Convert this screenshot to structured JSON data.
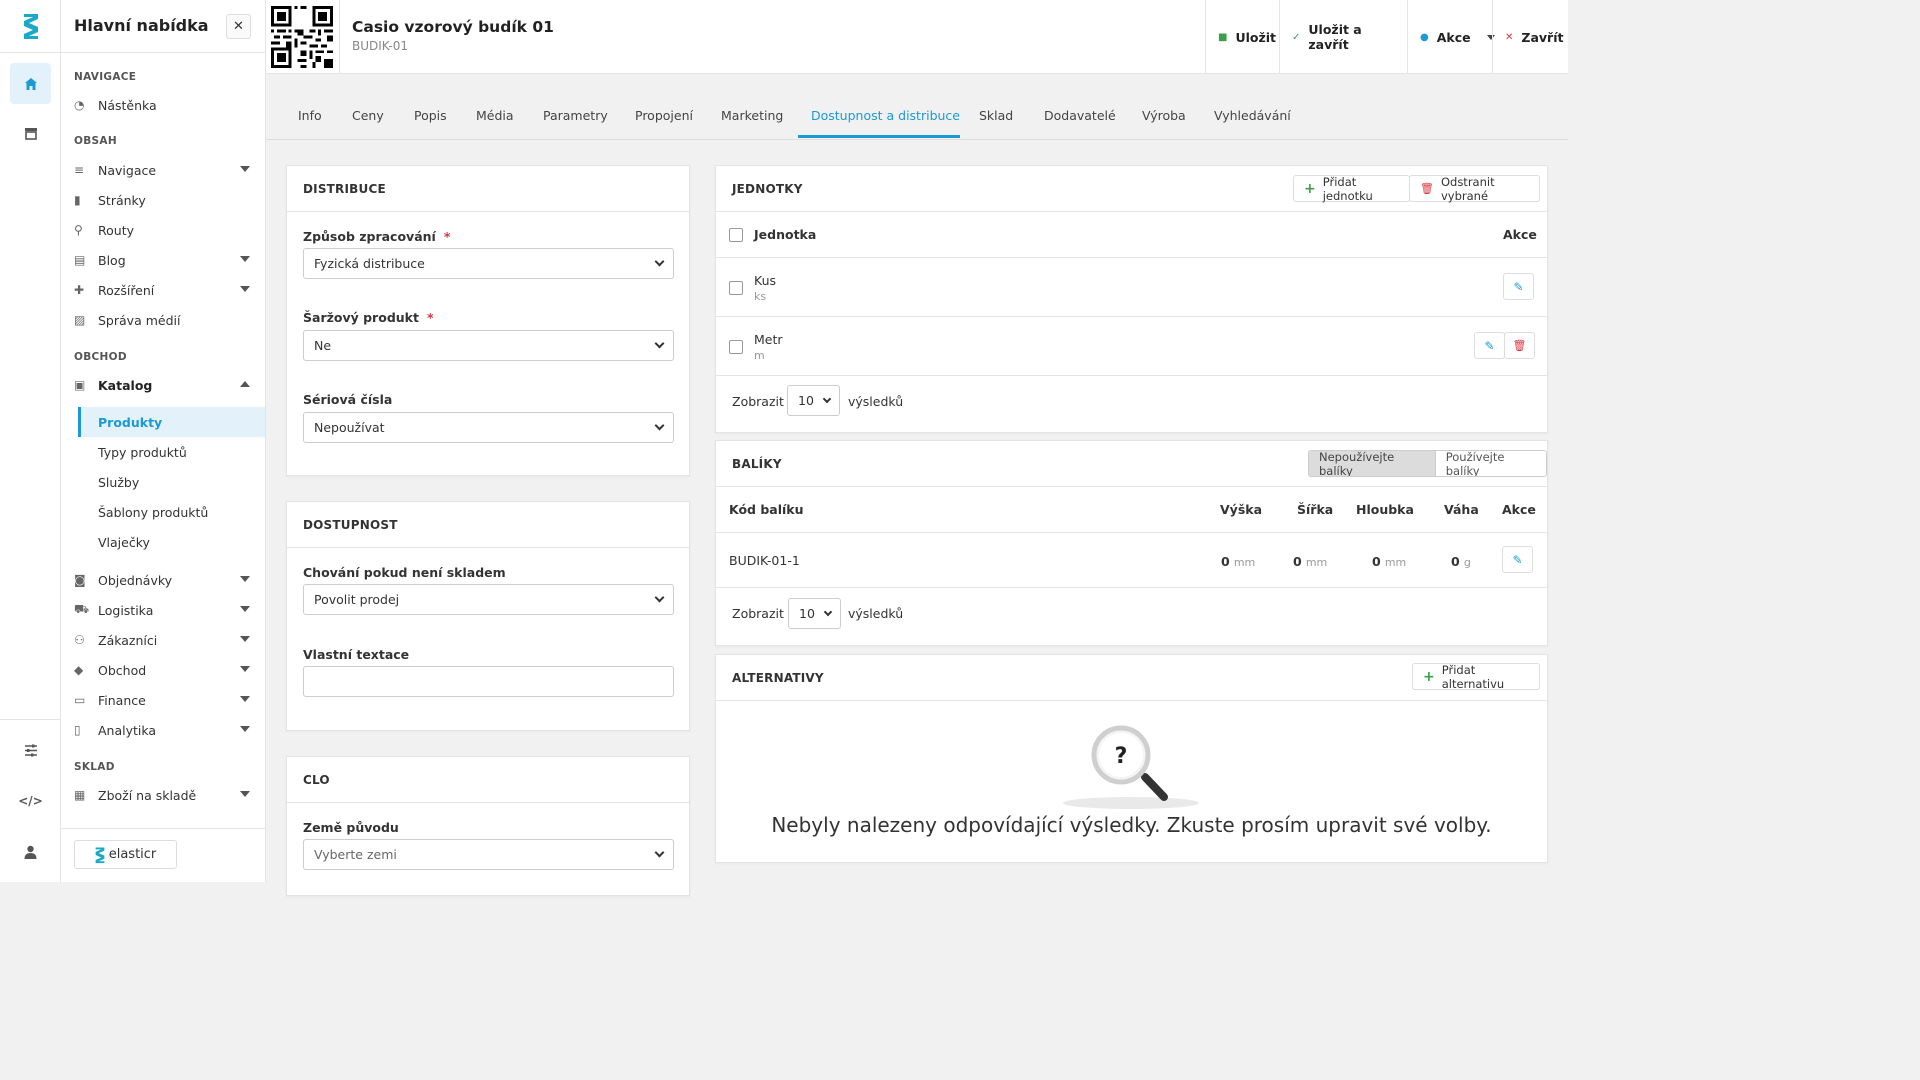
{
  "menu": {
    "title": "Hlavní nabídka",
    "sections": {
      "navigace": "NAVIGACE",
      "obsah": "OBSAH",
      "obchod": "OBCHOD",
      "sklad": "SKLAD"
    },
    "items": {
      "nastenka": "Nástěnka",
      "navigace": "Navigace",
      "stranky": "Stránky",
      "routy": "Routy",
      "blog": "Blog",
      "rozsireni": "Rozšíření",
      "sprava_medii": "Správa médií",
      "katalog": "Katalog",
      "produkty": "Produkty",
      "typy_produktu": "Typy produktů",
      "sluzby": "Služby",
      "sablony_produktu": "Šablony produktů",
      "vlajecky": "Vlaječky",
      "objednavky": "Objednávky",
      "logistika": "Logistika",
      "zakaznici": "Zákazníci",
      "obchod": "Obchod",
      "finance": "Finance",
      "analytika": "Analytika",
      "zbozi_na_sklade": "Zboží na skladě"
    },
    "brand": "elasticr"
  },
  "header": {
    "title": "Casio vzorový budík 01",
    "code": "BUDIK-01",
    "save": "Uložit",
    "save_close": "Uložit a zavřít",
    "actions": "Akce",
    "close": "Zavřít"
  },
  "tabs": [
    "Info",
    "Ceny",
    "Popis",
    "Média",
    "Parametry",
    "Propojení",
    "Marketing",
    "Dostupnost a distribuce",
    "Sklad",
    "Dodavatelé",
    "Výroba",
    "Vyhledávání"
  ],
  "distribuce": {
    "title": "DISTRIBUCE",
    "zpusob_label": "Způsob zpracování",
    "zpusob_value": "Fyzická distribuce",
    "sarzovy_label": "Šaržový produkt",
    "sarzovy_value": "Ne",
    "seriova_label": "Sériová čísla",
    "seriova_value": "Nepoužívat",
    "required_mark": "*"
  },
  "dostupnost": {
    "title": "DOSTUPNOST",
    "chovani_label": "Chování pokud není skladem",
    "chovani_value": "Povolit prodej",
    "textace_label": "Vlastní textace",
    "textace_value": ""
  },
  "clo": {
    "title": "CLO",
    "zeme_label": "Země původu",
    "zeme_placeholder": "Vyberte zemi"
  },
  "jednotky": {
    "title": "JEDNOTKY",
    "add": "Přidat jednotku",
    "remove": "Odstranit vybrané",
    "col_unit": "Jednotka",
    "col_actions": "Akce",
    "rows": [
      {
        "name": "Kus",
        "abbr": "ks"
      },
      {
        "name": "Metr",
        "abbr": "m"
      }
    ],
    "show": "Zobrazit",
    "per_page": "10",
    "results": "výsledků"
  },
  "baliky": {
    "title": "BALÍKY",
    "toggle_off": "Nepoužívejte balíky",
    "toggle_on": "Používejte balíky",
    "cols": {
      "code": "Kód balíku",
      "height": "Výška",
      "width": "Šířka",
      "depth": "Hloubka",
      "weight": "Váha",
      "actions": "Akce"
    },
    "rows": [
      {
        "code": "BUDIK-01-1",
        "height": "0",
        "height_unit": "mm",
        "width": "0",
        "width_unit": "mm",
        "depth": "0",
        "depth_unit": "mm",
        "weight": "0",
        "weight_unit": "g"
      }
    ],
    "show": "Zobrazit",
    "per_page": "10",
    "results": "výsledků"
  },
  "alternativy": {
    "title": "ALTERNATIVY",
    "add": "Přidat alternativu",
    "empty_icon_char": "?",
    "empty": "Nebyly nalezeny odpovídající výsledky. Zkuste prosím upravit své volby."
  },
  "colors": {
    "accent": "#1b9ad4",
    "danger": "#d9363e",
    "success": "#3aa14a"
  }
}
